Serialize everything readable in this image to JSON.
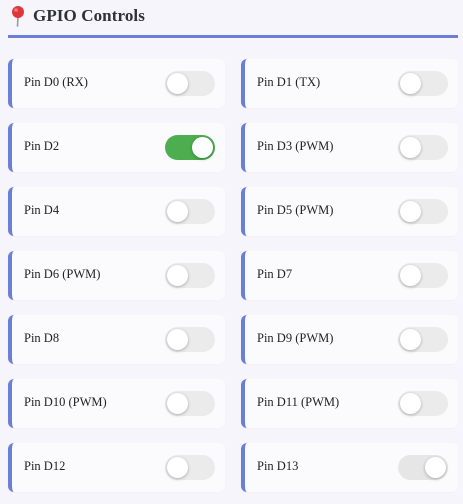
{
  "header": {
    "icon": "pushpin-icon",
    "title": "GPIO Controls",
    "accent_color": "#6b7fd7"
  },
  "pins": [
    {
      "label": "Pin D0 (RX)",
      "state": "off"
    },
    {
      "label": "Pin D1 (TX)",
      "state": "off"
    },
    {
      "label": "Pin D2",
      "state": "on"
    },
    {
      "label": "Pin D3 (PWM)",
      "state": "off"
    },
    {
      "label": "Pin D4",
      "state": "off"
    },
    {
      "label": "Pin D5 (PWM)",
      "state": "off"
    },
    {
      "label": "Pin D6 (PWM)",
      "state": "off"
    },
    {
      "label": "Pin D7",
      "state": "off"
    },
    {
      "label": "Pin D8",
      "state": "off"
    },
    {
      "label": "Pin D9 (PWM)",
      "state": "off"
    },
    {
      "label": "Pin D10 (PWM)",
      "state": "off"
    },
    {
      "label": "Pin D11 (PWM)",
      "state": "off"
    },
    {
      "label": "Pin D12",
      "state": "off"
    },
    {
      "label": "Pin D13",
      "state": "on-disabled"
    }
  ],
  "colors": {
    "toggle_on": "#4cae4f",
    "toggle_off": "#ebebeb",
    "toggle_disabled": "#e6e6e6"
  }
}
